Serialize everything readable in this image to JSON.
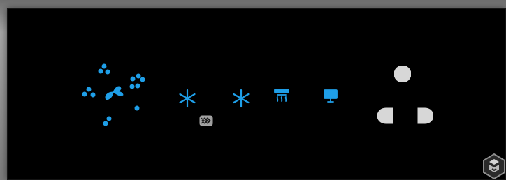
{
  "panel": {
    "background": "#000000",
    "accent": "#1f9fe8"
  },
  "icons": {
    "fan_mode": "fan-mode-icon",
    "snowflake_left": "snowflake-icon",
    "snowflake_right": "snowflake-icon",
    "heater": "heater-icon",
    "monitor": "monitor-icon",
    "filter": "filter-icon",
    "power_dot": "power-dot-icon",
    "power_left": "power-left-icon",
    "power_right": "power-right-icon",
    "watermark": "logo-icon"
  }
}
